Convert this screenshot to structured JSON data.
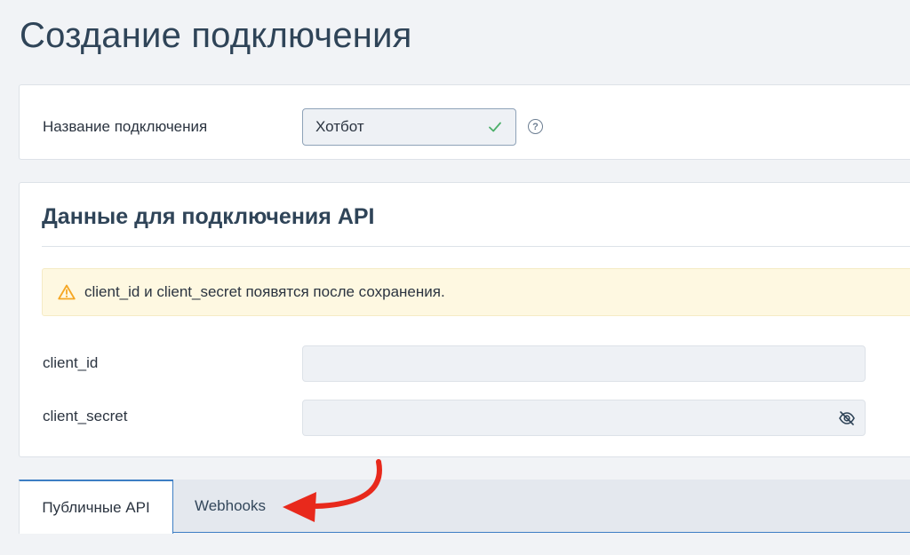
{
  "page": {
    "title": "Создание подключения"
  },
  "connection": {
    "name_label": "Название подключения",
    "name_value": "Хотбот",
    "help_glyph": "?"
  },
  "api": {
    "section_title": "Данные для подключения API",
    "alert_text": "client_id и client_secret появятся после сохранения.",
    "client_id_label": "client_id",
    "client_id_value": "",
    "client_secret_label": "client_secret",
    "client_secret_value": ""
  },
  "tabs": [
    {
      "label": "Публичные API",
      "active": true
    },
    {
      "label": "Webhooks",
      "active": false
    }
  ],
  "colors": {
    "accent": "#3d7ec4",
    "warning": "#f5a623",
    "success": "#4caf6a",
    "annotation": "#e8291c"
  },
  "icons": {
    "valid": "check-icon",
    "help": "help-circle-icon",
    "warning": "warning-triangle-icon",
    "reveal": "eye-slash-icon",
    "annotation": "curved-arrow-icon"
  }
}
